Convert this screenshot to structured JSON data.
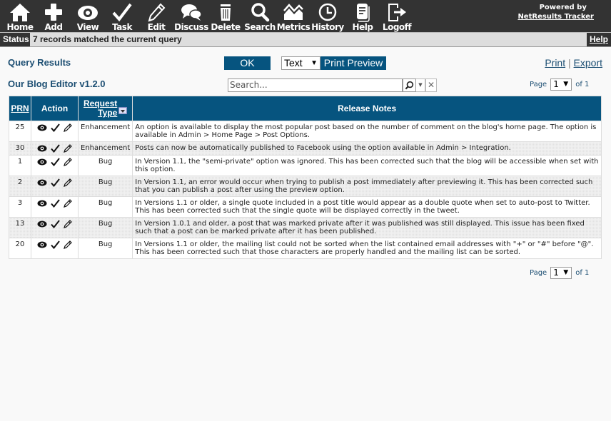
{
  "nav": {
    "items": [
      {
        "label": "Home",
        "icon": "home-icon"
      },
      {
        "label": "Add",
        "icon": "plus-icon"
      },
      {
        "label": "View",
        "icon": "eye-icon"
      },
      {
        "label": "Task",
        "icon": "checkmark-icon"
      },
      {
        "label": "Edit",
        "icon": "pencil-icon"
      },
      {
        "label": "Discuss",
        "icon": "chat-bubbles-icon"
      },
      {
        "label": "Delete",
        "icon": "trash-icon"
      },
      {
        "label": "Search",
        "icon": "magnifier-icon"
      },
      {
        "label": "Metrics",
        "icon": "metrics-chart-icon"
      },
      {
        "label": "History",
        "icon": "clock-icon"
      },
      {
        "label": "Help",
        "icon": "document-icon"
      },
      {
        "label": "Logoff",
        "icon": "logoff-arrow-icon"
      }
    ],
    "powered_by": "Powered by",
    "brand_link": "NetResults Tracker"
  },
  "status": {
    "label": "Status",
    "text": "7 records matched the current query",
    "help": "Help"
  },
  "toolbar": {
    "title": "Query Results",
    "subtitle": "Our Blog Editor v1.2.0",
    "ok_label": "OK",
    "format_selected": "Text",
    "print_preview_label": "Print Preview",
    "print_label": "Print",
    "separator": "|",
    "export_label": "Export",
    "search_placeholder": "Search..."
  },
  "pager": {
    "page_label": "Page",
    "current": "1",
    "of_label": "of 1"
  },
  "table": {
    "headers": {
      "prn": "PRN",
      "action": "Action",
      "request_type_1": "Request",
      "request_type_2": "Type",
      "release_notes": "Release Notes"
    },
    "rows": [
      {
        "prn": "25",
        "type": "Enhancement",
        "notes": "An option is available to display the most popular post based on the number of comment on the blog's home page. The option is available in Admin > Home Page > Post Options."
      },
      {
        "prn": "30",
        "type": "Enhancement",
        "notes": "Posts can now be automatically published to Facebook using the option available in Admin > Integration."
      },
      {
        "prn": "1",
        "type": "Bug",
        "notes": "In Version 1.1, the \"semi-private\" option was ignored. This has been corrected such that the blog will be accessible when set with this option."
      },
      {
        "prn": "2",
        "type": "Bug",
        "notes": "In Version 1.1, an error would occur when trying to publish a post immediately after previewing it. This has been corrected such that you can publish a post after using the preview option."
      },
      {
        "prn": "3",
        "type": "Bug",
        "notes": "In Versions 1.1 or older, a single quote included in a post title would appear as a double quote when set to auto-post to Twitter. This has been corrected such that the single quote will be displayed correctly in the tweet."
      },
      {
        "prn": "13",
        "type": "Bug",
        "notes": "In Version 1.0.1 and older, a post that was marked private after it was published was still displayed. This issue has been fixed such that a post can be marked private after it has been published."
      },
      {
        "prn": "20",
        "type": "Bug",
        "notes": "In Versions 1.1 or older, the mailing list could not be sorted when the list contained email addresses with \"+\" or \"#\" before \"@\". This has been corrected such that those characters are properly handled and the mailing list can be sorted."
      }
    ]
  }
}
